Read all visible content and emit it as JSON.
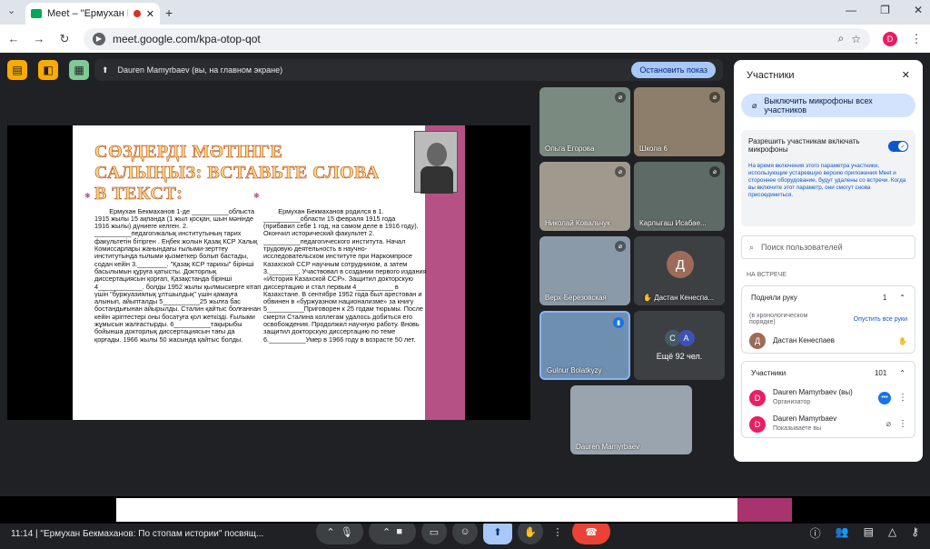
{
  "browser": {
    "tab_title": "Meet – \"Ермухан Бекмахан",
    "tab_close": "✕",
    "new_tab": "+",
    "url": "meet.google.com/kpa-otop-qot",
    "profile_initial": "D",
    "window_controls": [
      "—",
      "❐",
      "✕"
    ]
  },
  "presentation_bar": {
    "label": "Dauren Mamyrbaev (вы, на главном экране)",
    "stop_button": "Остановить показ"
  },
  "slide": {
    "title": "СӨЗДЕРДІ МӘТІНГЕ САЛЫҢЫЗ: ВСТАВЬТЕ СЛОВА В ТЕКСТ:",
    "bullet": "❋",
    "left_text": "Ермухан Бекмаханов 1-де __________облыста 1915 жылы 15 ақпанда (1 жыл қосқан, шын мәнінде 1916 жылы) дүниеге келген. 2. __________педагогикалық институтының тарих факультетін бітірген . Еңбек жолын Қазақ КСР Халық Комиссарлары жанындағы ғылыми-зерттеу институтында ғылыми қызметкер болып бастады, содан кейін 3.________. \"Қазақ КСР тарихы\" бірінші басылымын құруға қатысты. Докторлық диссертациясын қорғап, Қазақстанда бірінші 4____________. болды 1952 жылы қылмыскерге кітап үшін \"буржуазиялық ұлтшылдық\" үшін қамауға алынып, айыпталды 5__________25 жылға бас бостандығынан айырылды. Сталин қайтыс болғаннан кейін әріптестері оны босатуға қол жеткізді. Ғылыми жұмысын жалғастырды. 6__________тақырыбы бойынша докторлық диссертациясын тағы да қорғады. 1966 жылы 50 жасында қайтыс болды.",
    "right_text": "Ермухан Бекмаханов родился в 1. __________области 15 февраля 1915 года (прибавил себе 1 год, на самом деле в 1916 году). Окончил исторический факультет 2. __________педагогического института. Начал трудовую деятельность в научно-исследовательском институте при Наркомпросе Казахской ССР научным сотрудником, а затем 3.________. Участвовал в создании первого издания «История Казахской ССР». Защитил докторскую диссертацию и стал первым 4__________ в Казахстане. В сентябре 1952 года был арестован и обвинен в «буржуазном национализме» за книгу 5__________Приговорен к 25 годам тюрьмы. После смерти Сталина коллегам удалось добиться его освобождения. Продолжил научную работу. Вновь защитил докторскую диссертацию по теме 6.__________Умер в 1966 году в возрасте 50 лет."
  },
  "tiles": [
    {
      "name": "Ольга Егорова",
      "bg": "#7a8a80"
    },
    {
      "name": "Школа 6",
      "bg": "#8c7e6a"
    },
    {
      "name": "Николай Ковальчук",
      "bg": "#a09a8e"
    },
    {
      "name": "Карлыгаш Исабае...",
      "bg": "#5e6a66"
    },
    {
      "name": "Верх-Березовская",
      "bg": "#8a9aa8"
    },
    {
      "name": "Дастан Кенеспа...",
      "bg": "#3c4043",
      "initial": "Д"
    },
    {
      "name": "Gulnur Bolatkyzy",
      "bg": "#6e8fb0"
    },
    {
      "name": "Ещё 92 чел.",
      "bg": "#3c4043",
      "avatars": [
        "С",
        "А"
      ]
    },
    {
      "name": "Dauren Mamyrbaev",
      "bg": "#9aa4ae"
    }
  ],
  "panel": {
    "title": "Участники",
    "mute_all": "Выключить микрофоны всех участников",
    "allow_mics": "Разрешить участникам включать микрофоны",
    "allow_note": "На время включения этого параметра участники, использующие устаревшую версию приложения Meet и стороннее оборудование, будут удалены со встречи. Когда вы включите этот параметр, они смогут снова присоединиться.",
    "search_placeholder": "Поиск пользователей",
    "section": "НА ВСТРЕЧЕ",
    "raised_hands": {
      "label": "Подняли руку",
      "count": "1",
      "order": "(в хронологическом порядке)",
      "lower_all": "Опустить все руки",
      "person": "Дастан Кенеспаев",
      "person_initial": "Д"
    },
    "participants": {
      "label": "Участники",
      "count": "101",
      "people": [
        {
          "initial": "D",
          "name": "Dauren Mamyrbaev (вы)",
          "role": "Организатор"
        },
        {
          "initial": "D",
          "name": "Dauren Mamyrbaev",
          "role": "Показываете вы"
        }
      ]
    }
  },
  "bottom": {
    "time_title": "11:14 | \"Ермухан Бекмаханов: По стопам истории\" посвящ...",
    "people_badge": "101"
  },
  "colors": {
    "accent": "#0b57d0",
    "end_call": "#ea4335",
    "slide_border": "#a8336f",
    "present_active": "#a8c7fa"
  }
}
